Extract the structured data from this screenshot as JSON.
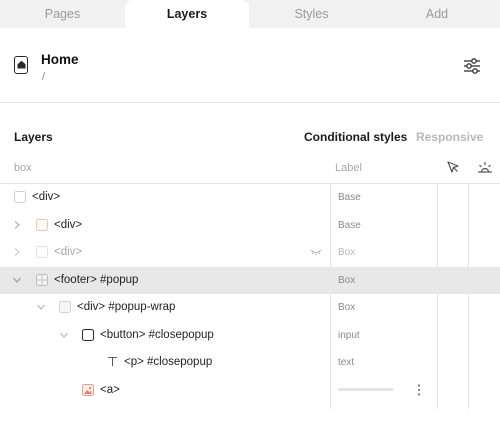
{
  "tabs": [
    "Pages",
    "Layers",
    "Styles",
    "Add"
  ],
  "page": {
    "title": "Home",
    "path": "/",
    "icon": "home-page-icon",
    "settings_icon": "sliders-icon"
  },
  "layers": {
    "title": "Layers",
    "conditional_tab": "Conditional styles",
    "responsive_tab": "Responsive",
    "search_placeholder": "box",
    "label_header": "Label",
    "header_icons": [
      "cursor-icon",
      "sun-icon"
    ],
    "rows": [
      {
        "label": "<div>",
        "style": "Base"
      },
      {
        "label": "<div>",
        "style": "Base"
      },
      {
        "label": "<div>",
        "style": "Box"
      },
      {
        "label": "<footer> #popup",
        "style": "Box"
      },
      {
        "label": "<div> #popup-wrap",
        "style": "Box"
      },
      {
        "label": "<button> #closepopup",
        "style": "input"
      },
      {
        "label": "<p> #closepopup",
        "style": "text"
      },
      {
        "label": "<a>",
        "style": ""
      }
    ]
  },
  "colors": {
    "tab_bar": "#f1f1f1",
    "selected_row": "#e8e8e8",
    "muted_text": "#a5a5a5"
  }
}
